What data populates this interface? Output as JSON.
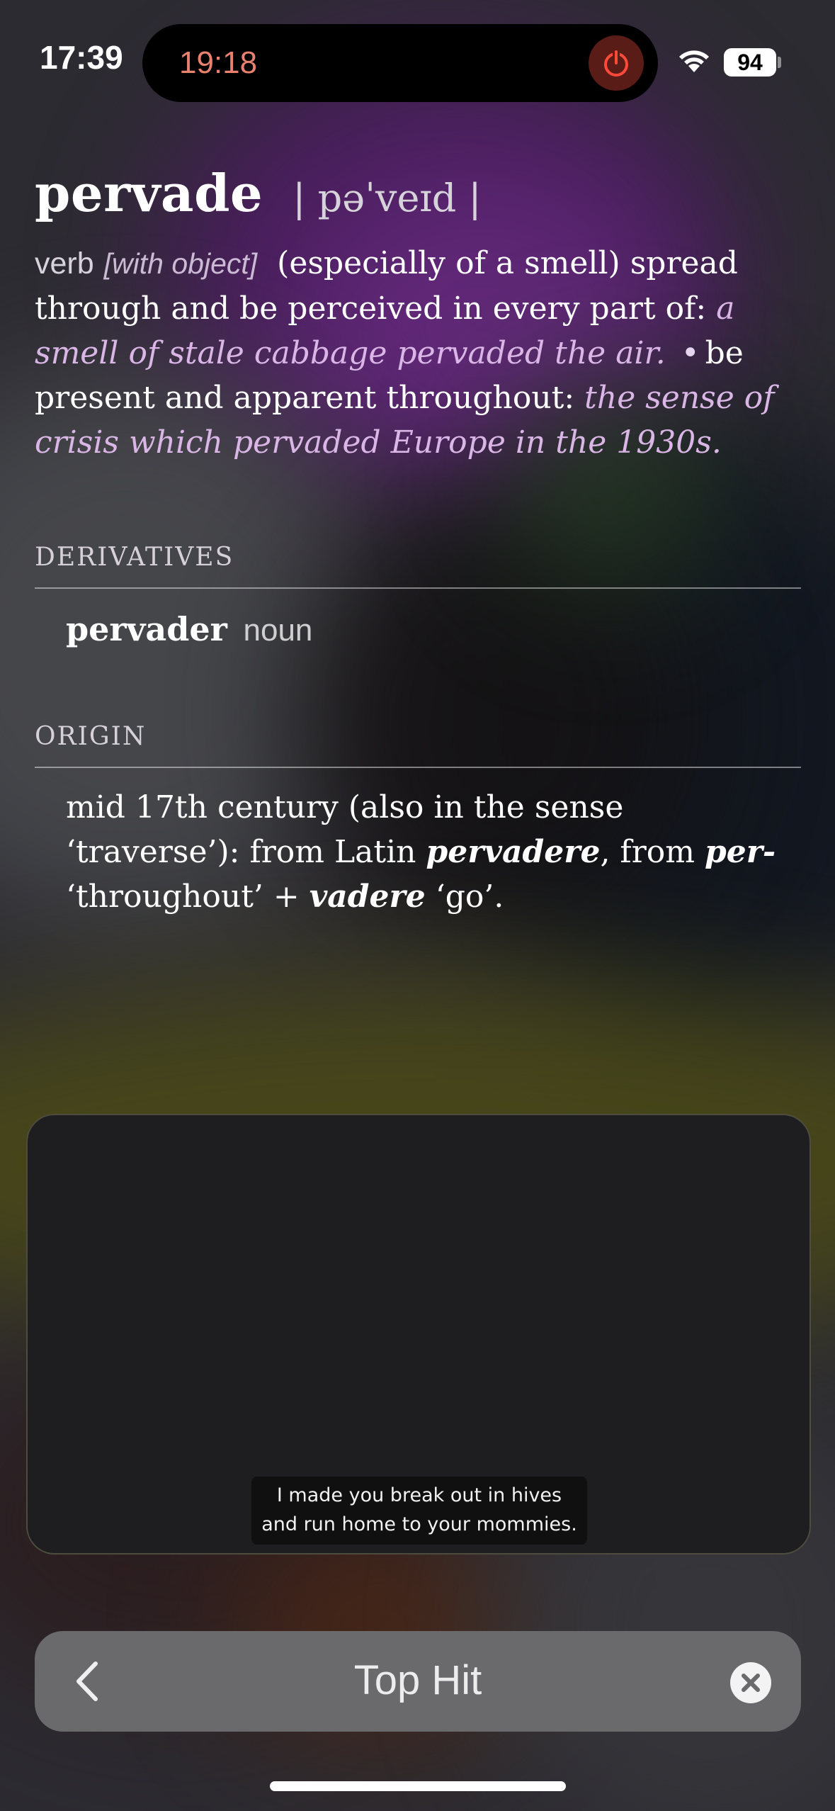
{
  "status_bar": {
    "time": "17:39",
    "timer": "19:18",
    "battery": "94",
    "icons": [
      "wifi-icon",
      "battery-icon",
      "power-icon"
    ]
  },
  "entry": {
    "headword": "pervade",
    "pronunciation": "| pəˈveɪd |",
    "pos": "verb",
    "subpos": "[with object]",
    "sense1_text": "(especially of a smell) spread through and be perceived in every part of: ",
    "sense1_example": "a smell of stale cabbage pervaded the air.",
    "bullet": "•",
    "sense2_text": "be present and apparent throughout: ",
    "sense2_example": "the sense of crisis which pervaded Europe in the 1930s."
  },
  "derivatives": {
    "heading": "DERIVATIVES",
    "word": "pervader",
    "pos": "noun"
  },
  "origin": {
    "heading": "ORIGIN",
    "t1": "mid 17th century (also in the sense ‘traverse’): from Latin ",
    "b1": "pervadere",
    "t2": ", from ",
    "b2": "per-",
    "t3": " ‘throughout’ + ",
    "b3": "vadere",
    "t4": " ‘go’."
  },
  "subtitle": {
    "line1": "I made you break out in hives",
    "line2": "and run home to your mommies."
  },
  "search": {
    "query": "Top Hit"
  },
  "colors": {
    "example": "#d9b6e6",
    "timer": "#e8826f",
    "search_bar": "#6a6a6d"
  }
}
